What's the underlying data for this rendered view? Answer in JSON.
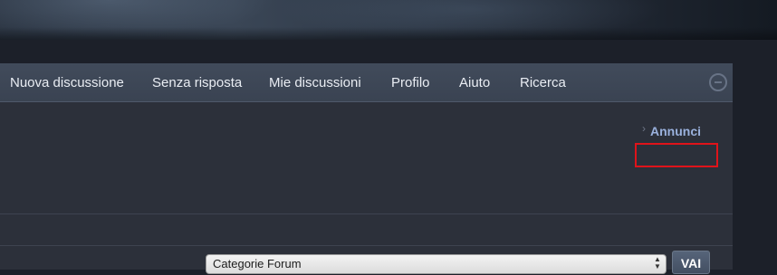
{
  "nav": {
    "items": [
      {
        "label": "Nuova discussione"
      },
      {
        "label": "Senza risposta"
      },
      {
        "label": "Mie discussioni"
      },
      {
        "label": "Profilo"
      },
      {
        "label": "Aiuto"
      },
      {
        "label": "Ricerca"
      }
    ]
  },
  "announcements": {
    "label": "Annunci"
  },
  "jump": {
    "select_value": "Categorie Forum",
    "button_label": "VAI"
  },
  "colors": {
    "navbar": "#3e4756",
    "content_bg": "#2c303a",
    "link": "#9ab1dd",
    "highlight": "#e0131a"
  }
}
